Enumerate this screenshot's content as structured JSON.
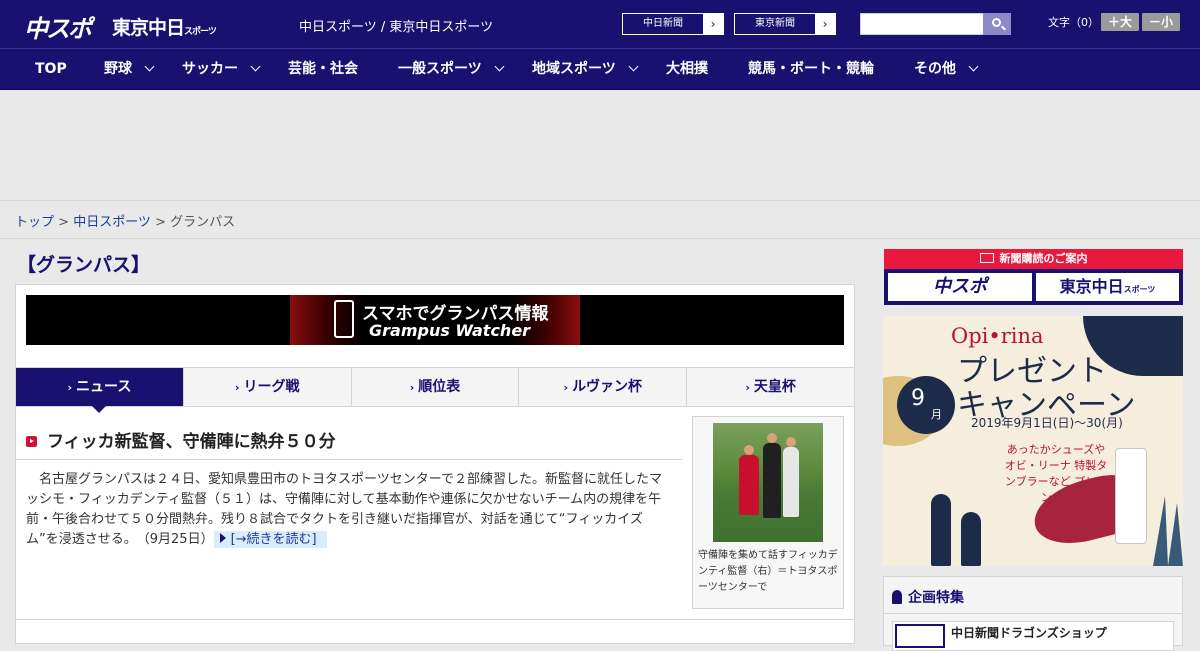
{
  "header": {
    "logo_chuspo": "中スポ",
    "logo_tokyo": "東京中日",
    "logo_tokyo_small": "スポーツ",
    "site_title": "中日スポーツ / 東京中日スポーツ",
    "paper_links": [
      "中日新聞",
      "東京新聞"
    ],
    "search": {
      "placeholder": "",
      "icon": "search-icon"
    },
    "font_size_label": "文字（0）",
    "font_larger": "＋大",
    "font_smaller": "－小"
  },
  "nav": {
    "items": [
      {
        "label": "TOP",
        "dropdown": false
      },
      {
        "label": "野球",
        "dropdown": true
      },
      {
        "label": "サッカー",
        "dropdown": true
      },
      {
        "label": "芸能・社会",
        "dropdown": false
      },
      {
        "label": "一般スポーツ",
        "dropdown": true
      },
      {
        "label": "地域スポーツ",
        "dropdown": true
      },
      {
        "label": "大相撲",
        "dropdown": false
      },
      {
        "label": "競馬・ボート・競輪",
        "dropdown": false
      },
      {
        "label": "その他",
        "dropdown": true
      }
    ]
  },
  "breadcrumb": {
    "items": [
      "トップ",
      "中日スポーツ",
      "グランパス"
    ],
    "separator": " > "
  },
  "page": {
    "heading": "【グランパス】",
    "banner_line1": "スマホでグランパス情報",
    "banner_line2": "Grampus Watcher",
    "tabs": [
      {
        "label": "ニュース",
        "active": true
      },
      {
        "label": "リーグ戦",
        "active": false
      },
      {
        "label": "順位表",
        "active": false
      },
      {
        "label": "ルヴァン杯",
        "active": false
      },
      {
        "label": "天皇杯",
        "active": false
      }
    ],
    "article": {
      "title": "フィッカ新監督、守備陣に熱弁５０分",
      "body": "名古屋グランパスは２４日、愛知県豊田市のトヨタスポーツセンターで２部練習した。新監督に就任したマッシモ・フィッカデンティ監督（５１）は、守備陣に対して基本動作や連係に欠かせないチーム内の規律を午前・午後合わせて５０分間熱弁。残り８試合でタクトを引き継いだ指揮官が、対話を通じて“フィッカイズム”を浸透させる。",
      "date": "（9月25日）",
      "more": "[→続きを読む]",
      "photo_caption": "守備陣を集めて話すフィッカデンティ監督（右）＝トヨタスポーツセンターで"
    }
  },
  "sidebar": {
    "subscribe_heading": "新聞購読のご案内",
    "subscribe_buttons": [
      "中スポ",
      "東京中日"
    ],
    "subscribe_small": "スポーツ",
    "campaign": {
      "brand": "Opi•rina",
      "title_line1": "プレゼント",
      "title_line2": "キャンペーン",
      "month_num": "9",
      "month_unit": "月",
      "dates": "2019年9月1日(日)〜30(月)",
      "copy": "あったかシューズや オビ・リーナ 特製タンブラーなど プレゼント!!"
    },
    "feature_heading": "企画特集",
    "feature_item": "中日新聞ドラゴンズショップ"
  },
  "colors": {
    "brand_navy": "#1a1070",
    "accent_red": "#e8193c",
    "link_blue": "#1a3ca0"
  }
}
